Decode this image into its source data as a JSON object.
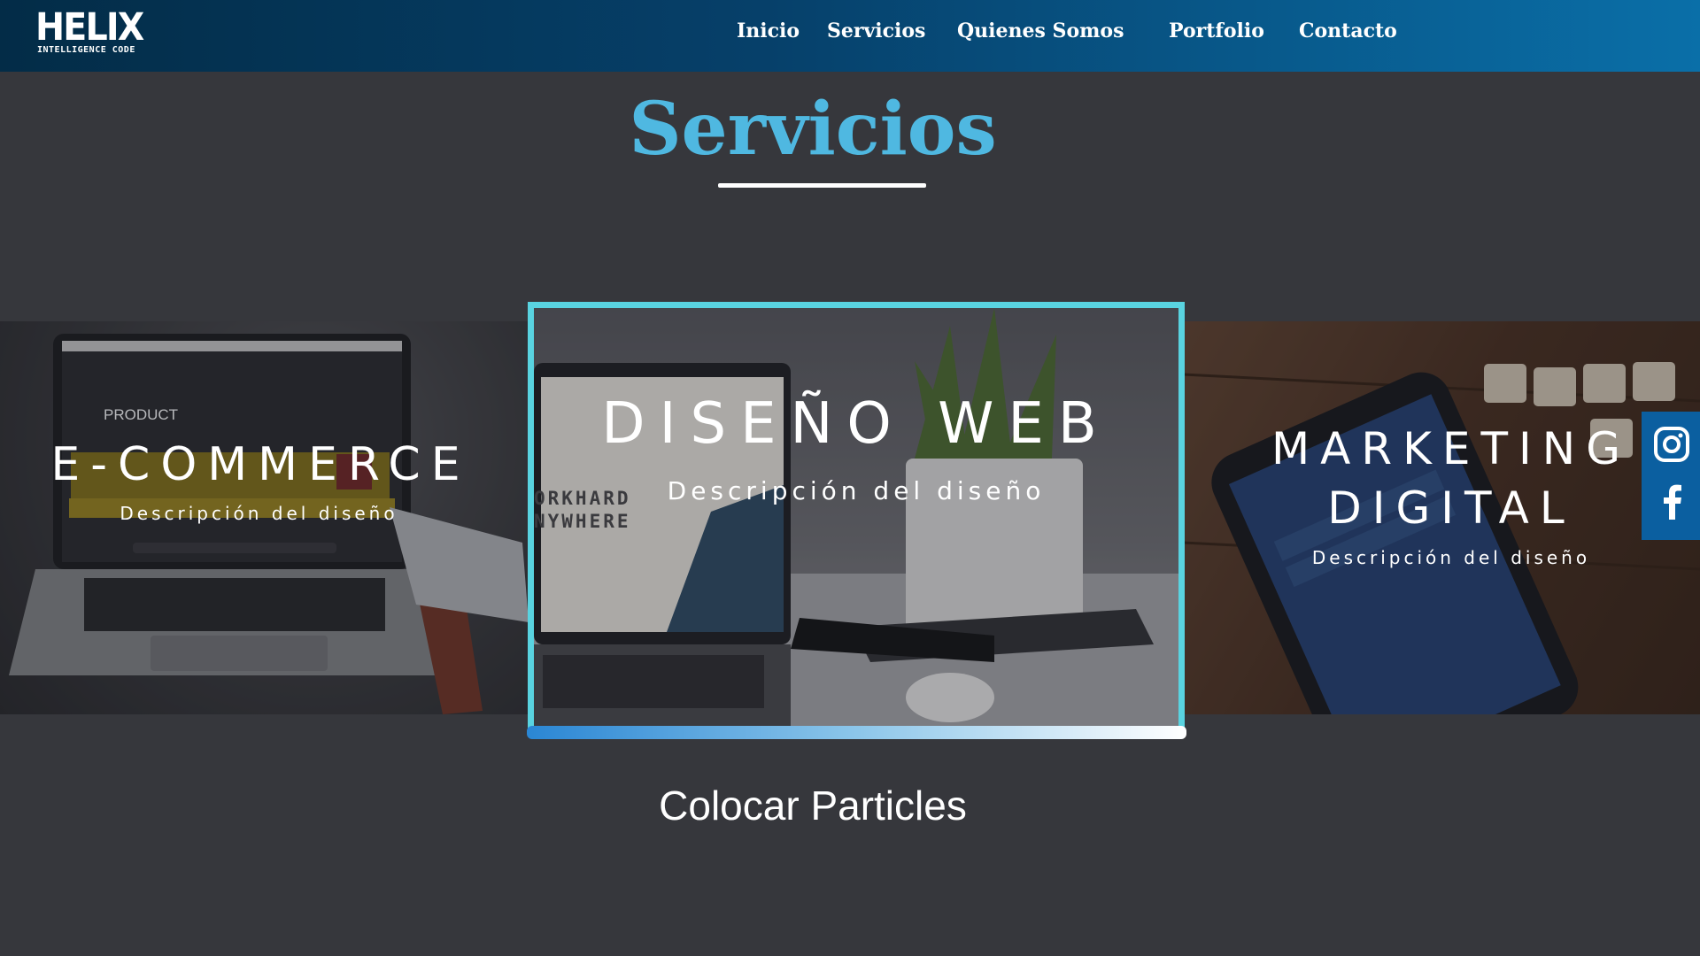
{
  "header": {
    "logo_main": "HELIX",
    "logo_sub": "INTELLIGENCE CODE",
    "nav": [
      {
        "label": "Inicio"
      },
      {
        "label": "Servicios"
      },
      {
        "label": "Quienes Somos"
      },
      {
        "label": "Portfolio"
      },
      {
        "label": "Contacto"
      }
    ]
  },
  "section": {
    "title": "Servicios"
  },
  "cards": [
    {
      "title": "E-COMMERCE",
      "description": "Descripción del diseño",
      "image_caption": "PRODUCT"
    },
    {
      "title": "DISEÑO WEB",
      "description": "Descripción del diseño",
      "image_caption_1": "ORKHARD",
      "image_caption_2": "NYWHERE"
    },
    {
      "title_line1": "MARKETING",
      "title_line2": "DIGITAL",
      "description": "Descripción del diseño"
    }
  ],
  "footer": {
    "particles_text": "Colocar Particles"
  },
  "social": [
    {
      "icon": "instagram-icon"
    },
    {
      "icon": "facebook-icon"
    }
  ],
  "colors": {
    "accent_title": "#4fb8e1",
    "card_border": "#59d3e0",
    "page_bg": "#36373c",
    "header_start": "#032c47",
    "header_end": "#0a6fa8",
    "social_bg": "#0b5fa0"
  }
}
